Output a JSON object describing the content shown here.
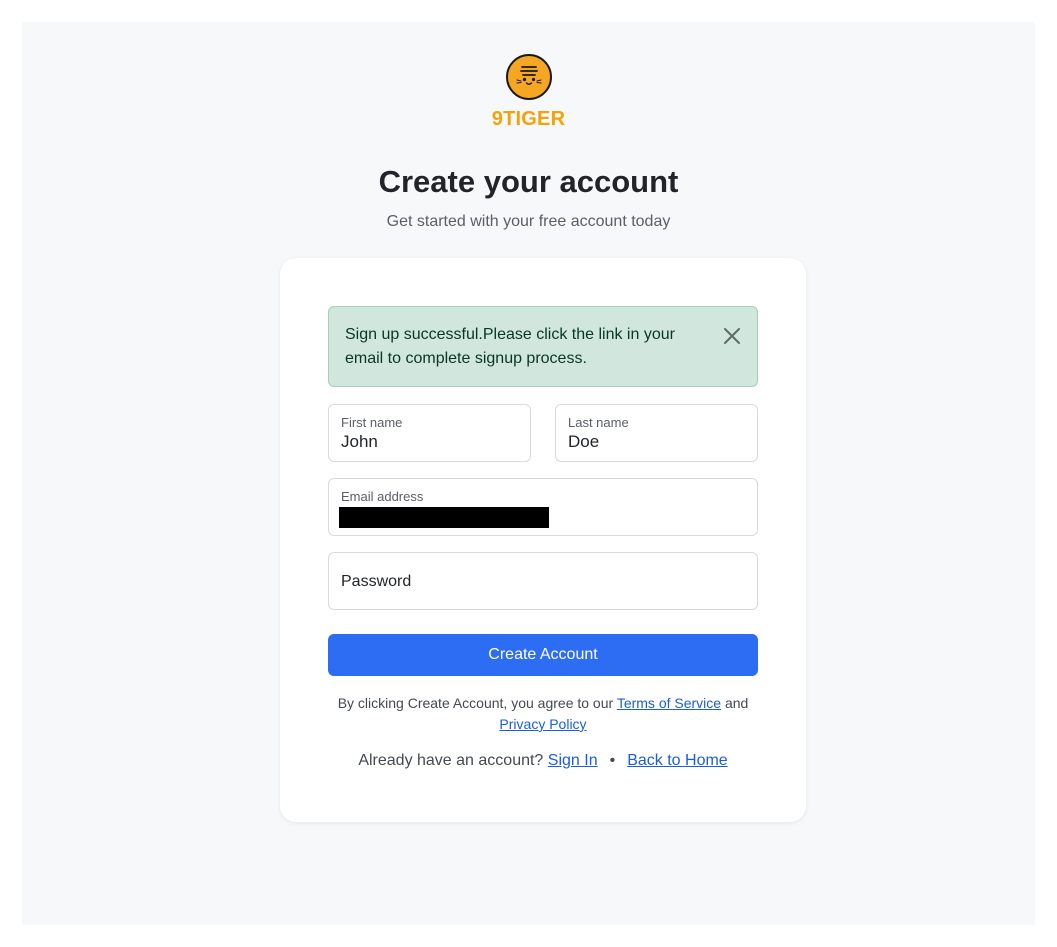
{
  "brand": {
    "name": "9TIGER",
    "logo_icon": "tiger-face-icon",
    "accent": "#f5a20a"
  },
  "header": {
    "title": "Create your account",
    "subtitle": "Get started with your free account today"
  },
  "alert": {
    "message": "Sign up successful.Please click the link in your email to complete signup process.",
    "close_icon": "close-icon",
    "bg": "#d1e7dd"
  },
  "form": {
    "first_name": {
      "label": "First name",
      "value": "John"
    },
    "last_name": {
      "label": "Last name",
      "value": "Doe"
    },
    "email": {
      "label": "Email address",
      "value": ""
    },
    "password": {
      "placeholder": "Password"
    },
    "submit_label": "Create Account",
    "submit_color": "#2c6df4"
  },
  "terms": {
    "prefix": "By clicking Create Account, you agree to our ",
    "tos_link": "Terms of Service",
    "middle": " and ",
    "privacy_link": "Privacy Policy"
  },
  "footer": {
    "prompt": "Already have an account? ",
    "sign_in": "Sign In",
    "separator": "•",
    "back_home": "Back to Home"
  }
}
